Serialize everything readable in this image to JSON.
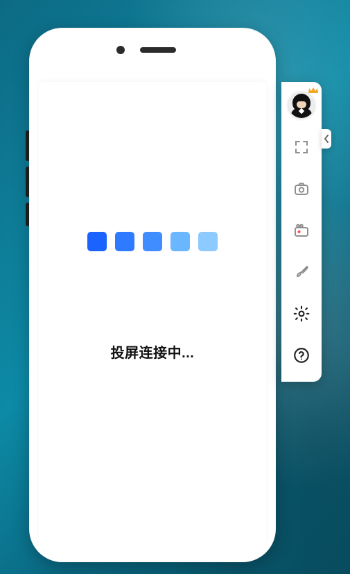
{
  "status_text": "投屏连接中...",
  "loader": {
    "colors": [
      "#1a63ff",
      "#2f7bff",
      "#3f8dff",
      "#6bb7ff",
      "#8ccaff"
    ]
  },
  "toolbar": {
    "avatar": {
      "name": "user-avatar",
      "badge": "crown"
    },
    "items": [
      {
        "name": "fullscreen-icon"
      },
      {
        "name": "camera-icon"
      },
      {
        "name": "record-icon"
      },
      {
        "name": "brush-icon"
      },
      {
        "name": "settings-icon"
      },
      {
        "name": "help-icon"
      }
    ]
  },
  "collapse": {
    "name": "collapse-toolbar-chevron"
  }
}
